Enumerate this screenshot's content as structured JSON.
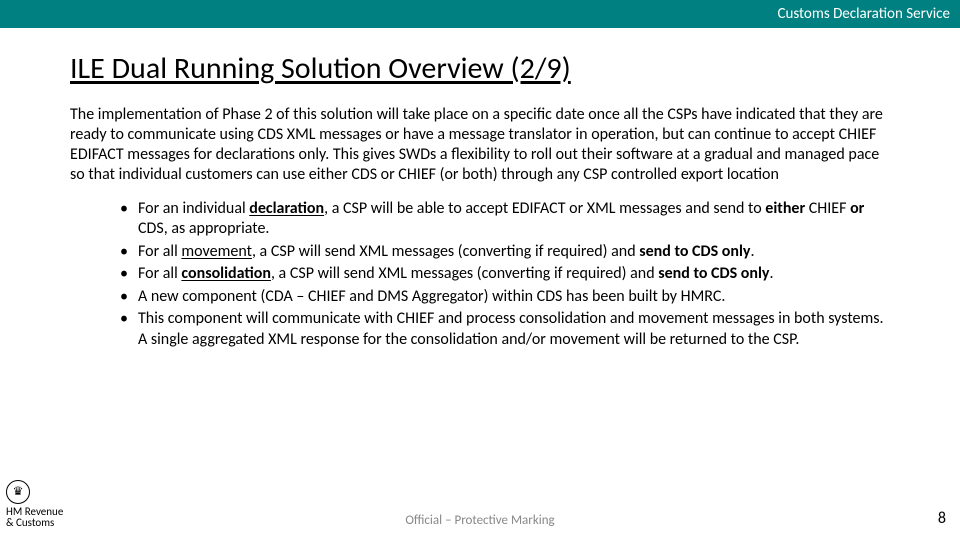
{
  "header": {
    "service": "Customs Declaration Service"
  },
  "title": "ILE Dual Running Solution Overview (2/9)",
  "intro": "The implementation of Phase 2 of this solution will take place on a specific date once all the CSPs have indicated that they are ready to communicate using CDS XML messages or have a message translator in operation, but can continue to accept CHIEF EDIFACT messages for declarations only. This gives SWDs a flexibility to roll out their software at a gradual and managed pace so that individual customers can use either CDS or CHIEF (or both) through any CSP controlled export location",
  "bullets": [
    {
      "pre": "For an individual ",
      "bu": "declaration",
      "mid": ", a CSP will be able to accept EDIFACT or XML messages and send to ",
      "b2": "either ",
      "post2": "CHIEF ",
      "b3": "or ",
      "post3": "CDS, as appropriate."
    },
    {
      "pre": "For all ",
      "u": "movement",
      "mid": ", a CSP will send XML messages (converting if required) and ",
      "b": "send to CDS only",
      "post": "."
    },
    {
      "pre": "For all ",
      "bu": "consolidation",
      "mid": ", a CSP will send XML messages (converting if required) and ",
      "b": "send to CDS only",
      "post": "."
    },
    {
      "text": "A new component (CDA – CHIEF and DMS Aggregator) within CDS has been built by HMRC."
    },
    {
      "text": "This component will communicate with CHIEF and process consolidation and movement messages in both systems. A single aggregated XML response for the consolidation and/or movement will be returned to the CSP."
    }
  ],
  "footer": {
    "org_line1": "HM Revenue",
    "org_line2": "& Customs",
    "marking": "Official – Protective Marking",
    "page": "8"
  }
}
